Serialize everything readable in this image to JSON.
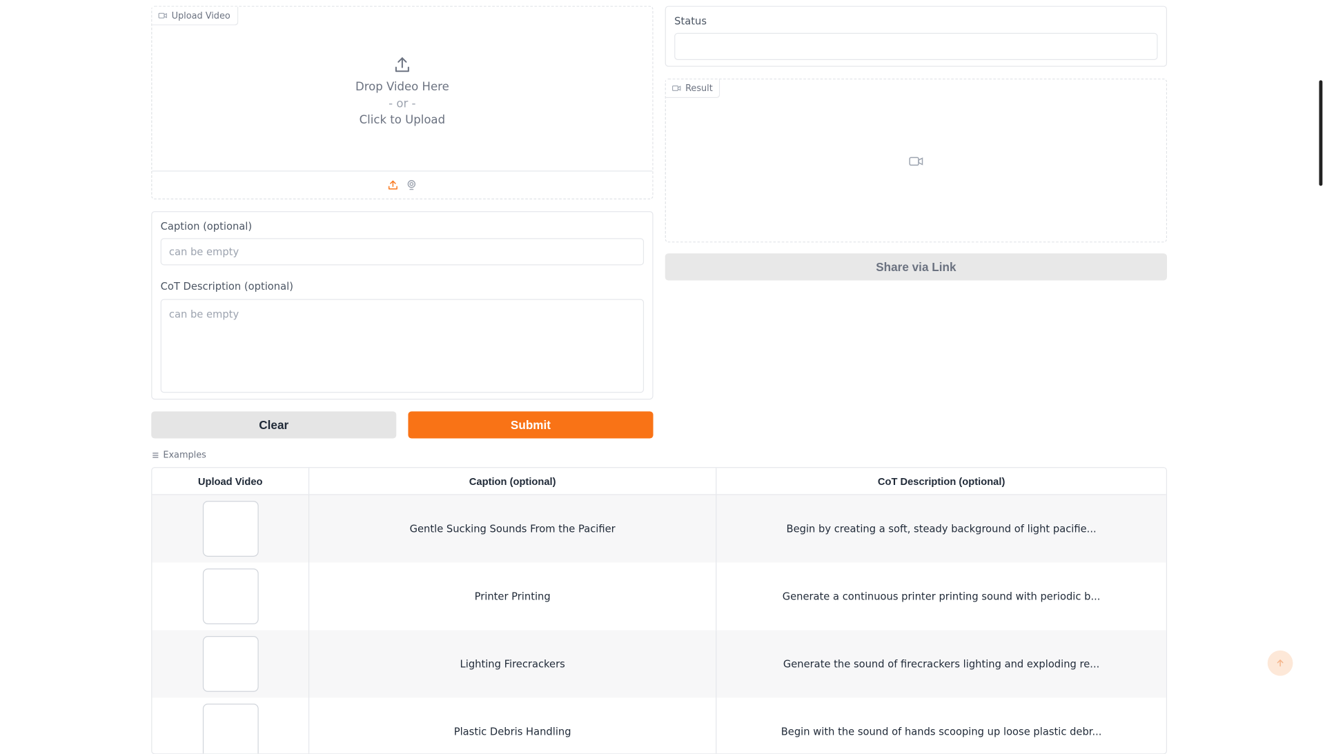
{
  "upload_video": {
    "label": "Upload Video",
    "drop_text": "Drop Video Here",
    "or_text": "- or -",
    "click_text": "Click to Upload"
  },
  "status": {
    "label": "Status",
    "value": ""
  },
  "result": {
    "label": "Result"
  },
  "share_button": "Share via Link",
  "caption": {
    "label": "Caption (optional)",
    "placeholder": "can be empty"
  },
  "cot": {
    "label": "CoT Description (optional)",
    "placeholder": "can be empty"
  },
  "buttons": {
    "clear": "Clear",
    "submit": "Submit"
  },
  "examples": {
    "label": "Examples",
    "headers": [
      "Upload Video",
      "Caption (optional)",
      "CoT Description (optional)"
    ],
    "rows": [
      {
        "caption": "Gentle Sucking Sounds From the Pacifier",
        "cot": "Begin by creating a soft, steady background of light pacifie..."
      },
      {
        "caption": "Printer Printing",
        "cot": "Generate a continuous printer printing sound with periodic b..."
      },
      {
        "caption": "Lighting Firecrackers",
        "cot": "Generate the sound of firecrackers lighting and exploding re..."
      },
      {
        "caption": "Plastic Debris Handling",
        "cot": "Begin with the sound of hands scooping up loose plastic debr..."
      }
    ]
  },
  "colors": {
    "accent": "#f97316",
    "secondary_button": "#e5e5e5"
  }
}
